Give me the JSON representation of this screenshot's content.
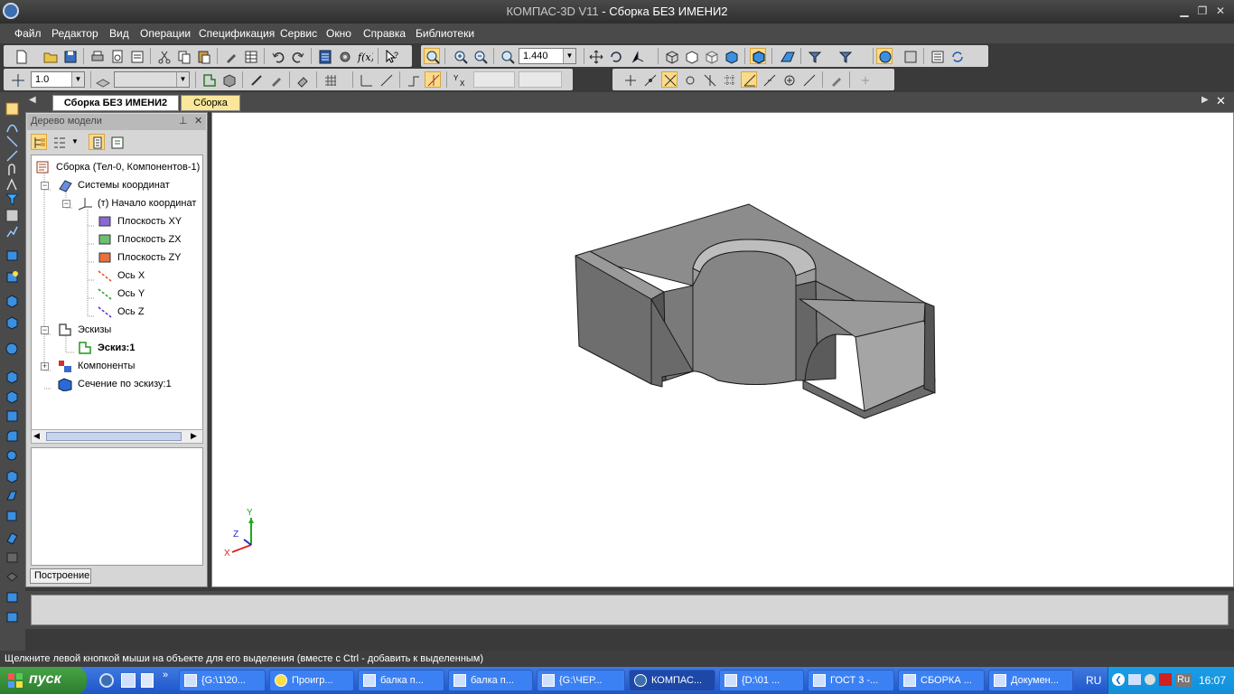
{
  "window": {
    "app_name": "КОМПАС-3D V11",
    "separator": " - ",
    "doc_title": "Сборка БЕЗ ИМЕНИ2"
  },
  "menu": [
    "Файл",
    "Редактор",
    "Вид",
    "Операции",
    "Спецификация",
    "Сервис",
    "Окно",
    "Справка",
    "Библиотеки"
  ],
  "toolbar": {
    "zoom_value": "1.440",
    "line_scale": "1.0"
  },
  "tabs": [
    {
      "label": "Сборка БЕЗ ИМЕНИ2"
    },
    {
      "label": "Сборка"
    }
  ],
  "tree": {
    "title": "Дерево модели",
    "nodes": [
      {
        "label": "Сборка (Тел-0, Компонентов-1)"
      },
      {
        "label": "Системы координат"
      },
      {
        "label": "(т) Начало координат"
      },
      {
        "label": "Плоскость XY"
      },
      {
        "label": "Плоскость ZX"
      },
      {
        "label": "Плоскость ZY"
      },
      {
        "label": "Ось X"
      },
      {
        "label": "Ось Y"
      },
      {
        "label": "Ось Z"
      },
      {
        "label": "Эскизы"
      },
      {
        "label": "Эскиз:1"
      },
      {
        "label": "Компоненты"
      },
      {
        "label": "Сечение по эскизу:1"
      }
    ],
    "bottom_tab": "Построение"
  },
  "axes": {
    "x": "X",
    "y": "Y",
    "z": "Z"
  },
  "status_text": "Щелкните левой кнопкой мыши на объекте для его выделения (вместе с Ctrl - добавить к выделенным)",
  "taskbar": {
    "start_label": "пуск",
    "chevron": "»",
    "items": [
      {
        "label": "{G:\\1\\20..."
      },
      {
        "label": "Проигр..."
      },
      {
        "label": "балка п..."
      },
      {
        "label": "балка п..."
      },
      {
        "label": "{G:\\ЧЕР..."
      },
      {
        "label": "КОМПАС..."
      },
      {
        "label": "{D:\\01 ..."
      },
      {
        "label": "ГОСТ 3 -..."
      },
      {
        "label": "СБОРКА ..."
      },
      {
        "label": "Докумен..."
      }
    ],
    "lang": "RU",
    "tray_lang": "Ru",
    "clock": "16:07"
  }
}
